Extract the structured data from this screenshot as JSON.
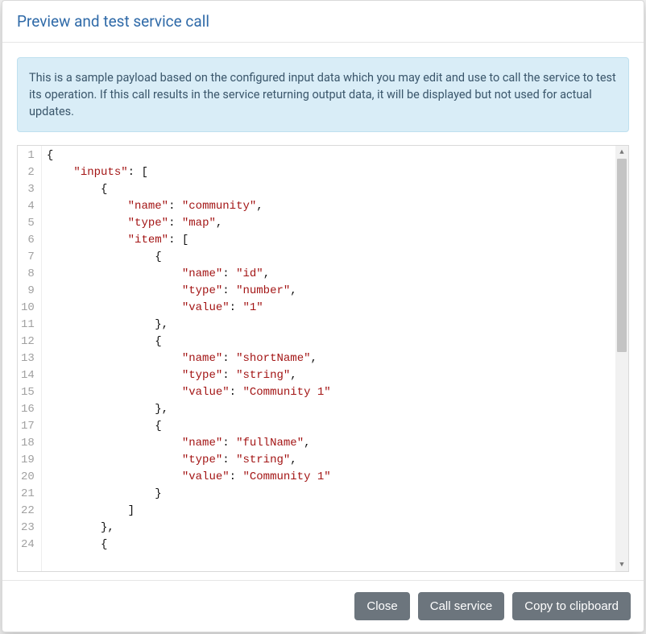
{
  "modal": {
    "title": "Preview and test service call",
    "alert_text": "This is a sample payload based on the configured input data which you may edit and use to call the service to test its operation. If this call results in the service returning output data, it will be displayed but not used for actual updates."
  },
  "editor": {
    "line_count_visible": 24,
    "lines": [
      [
        {
          "t": "{",
          "c": "p"
        }
      ],
      [
        {
          "t": "    ",
          "c": "p"
        },
        {
          "t": "\"inputs\"",
          "c": "k"
        },
        {
          "t": ": [",
          "c": "p"
        }
      ],
      [
        {
          "t": "        {",
          "c": "p"
        }
      ],
      [
        {
          "t": "            ",
          "c": "p"
        },
        {
          "t": "\"name\"",
          "c": "k"
        },
        {
          "t": ": ",
          "c": "p"
        },
        {
          "t": "\"community\"",
          "c": "s"
        },
        {
          "t": ",",
          "c": "p"
        }
      ],
      [
        {
          "t": "            ",
          "c": "p"
        },
        {
          "t": "\"type\"",
          "c": "k"
        },
        {
          "t": ": ",
          "c": "p"
        },
        {
          "t": "\"map\"",
          "c": "s"
        },
        {
          "t": ",",
          "c": "p"
        }
      ],
      [
        {
          "t": "            ",
          "c": "p"
        },
        {
          "t": "\"item\"",
          "c": "k"
        },
        {
          "t": ": [",
          "c": "p"
        }
      ],
      [
        {
          "t": "                {",
          "c": "p"
        }
      ],
      [
        {
          "t": "                    ",
          "c": "p"
        },
        {
          "t": "\"name\"",
          "c": "k"
        },
        {
          "t": ": ",
          "c": "p"
        },
        {
          "t": "\"id\"",
          "c": "s"
        },
        {
          "t": ",",
          "c": "p"
        }
      ],
      [
        {
          "t": "                    ",
          "c": "p"
        },
        {
          "t": "\"type\"",
          "c": "k"
        },
        {
          "t": ": ",
          "c": "p"
        },
        {
          "t": "\"number\"",
          "c": "s"
        },
        {
          "t": ",",
          "c": "p"
        }
      ],
      [
        {
          "t": "                    ",
          "c": "p"
        },
        {
          "t": "\"value\"",
          "c": "k"
        },
        {
          "t": ": ",
          "c": "p"
        },
        {
          "t": "\"1\"",
          "c": "s"
        }
      ],
      [
        {
          "t": "                },",
          "c": "p"
        }
      ],
      [
        {
          "t": "                {",
          "c": "p"
        }
      ],
      [
        {
          "t": "                    ",
          "c": "p"
        },
        {
          "t": "\"name\"",
          "c": "k"
        },
        {
          "t": ": ",
          "c": "p"
        },
        {
          "t": "\"shortName\"",
          "c": "s"
        },
        {
          "t": ",",
          "c": "p"
        }
      ],
      [
        {
          "t": "                    ",
          "c": "p"
        },
        {
          "t": "\"type\"",
          "c": "k"
        },
        {
          "t": ": ",
          "c": "p"
        },
        {
          "t": "\"string\"",
          "c": "s"
        },
        {
          "t": ",",
          "c": "p"
        }
      ],
      [
        {
          "t": "                    ",
          "c": "p"
        },
        {
          "t": "\"value\"",
          "c": "k"
        },
        {
          "t": ": ",
          "c": "p"
        },
        {
          "t": "\"Community 1\"",
          "c": "s"
        }
      ],
      [
        {
          "t": "                },",
          "c": "p"
        }
      ],
      [
        {
          "t": "                {",
          "c": "p"
        }
      ],
      [
        {
          "t": "                    ",
          "c": "p"
        },
        {
          "t": "\"name\"",
          "c": "k"
        },
        {
          "t": ": ",
          "c": "p"
        },
        {
          "t": "\"fullName\"",
          "c": "s"
        },
        {
          "t": ",",
          "c": "p"
        }
      ],
      [
        {
          "t": "                    ",
          "c": "p"
        },
        {
          "t": "\"type\"",
          "c": "k"
        },
        {
          "t": ": ",
          "c": "p"
        },
        {
          "t": "\"string\"",
          "c": "s"
        },
        {
          "t": ",",
          "c": "p"
        }
      ],
      [
        {
          "t": "                    ",
          "c": "p"
        },
        {
          "t": "\"value\"",
          "c": "k"
        },
        {
          "t": ": ",
          "c": "p"
        },
        {
          "t": "\"Community 1\"",
          "c": "s"
        }
      ],
      [
        {
          "t": "                }",
          "c": "p"
        }
      ],
      [
        {
          "t": "            ]",
          "c": "p"
        }
      ],
      [
        {
          "t": "        },",
          "c": "p"
        }
      ],
      [
        {
          "t": "        {",
          "c": "p"
        }
      ]
    ],
    "payload_object": {
      "inputs": [
        {
          "name": "community",
          "type": "map",
          "item": [
            {
              "name": "id",
              "type": "number",
              "value": "1"
            },
            {
              "name": "shortName",
              "type": "string",
              "value": "Community 1"
            },
            {
              "name": "fullName",
              "type": "string",
              "value": "Community 1"
            }
          ]
        }
      ]
    }
  },
  "footer": {
    "close_label": "Close",
    "call_service_label": "Call service",
    "copy_label": "Copy to clipboard"
  }
}
